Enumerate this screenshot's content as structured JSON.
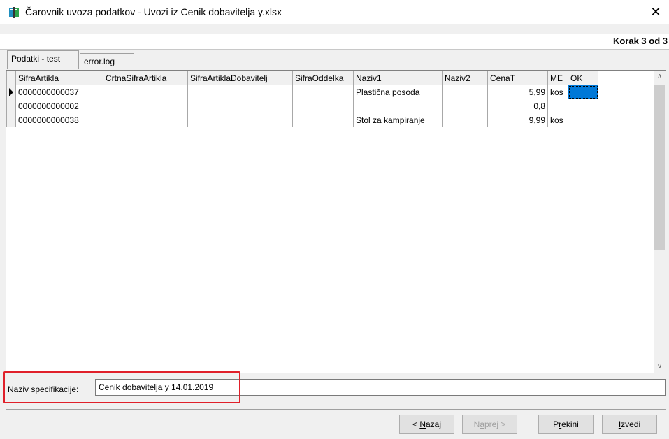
{
  "window": {
    "title": "Čarovnik uvoza podatkov - Uvozi iz Cenik dobavitelja y.xlsx",
    "close_glyph": "✕",
    "app_icon": "wizard-book-icon"
  },
  "step": {
    "label": "Korak 3 od 3"
  },
  "tabs": [
    {
      "label": "Podatki - test",
      "active": true
    },
    {
      "label": "error.log",
      "active": false
    }
  ],
  "grid": {
    "columns": [
      "SifraArtikla",
      "CrtnaSifraArtikla",
      "SifraArtiklaDobavitelj",
      "SifraOddelka",
      "Naziv1",
      "Naziv2",
      "CenaT",
      "ME",
      "OK"
    ],
    "rows": [
      {
        "SifraArtikla": "0000000000037",
        "CrtnaSifraArtikla": "",
        "SifraArtiklaDobavitelj": "",
        "SifraOddelka": "",
        "Naziv1": "Plastična posoda",
        "Naziv2": "",
        "CenaT": "5,99",
        "ME": "kos",
        "OK": "",
        "current": true
      },
      {
        "SifraArtikla": "0000000000002",
        "CrtnaSifraArtikla": "",
        "SifraArtiklaDobavitelj": "",
        "SifraOddelka": "",
        "Naziv1": "",
        "Naziv2": "",
        "CenaT": "0,8",
        "ME": "",
        "OK": "",
        "current": false
      },
      {
        "SifraArtikla": "0000000000038",
        "CrtnaSifraArtikla": "",
        "SifraArtiklaDobavitelj": "",
        "SifraOddelka": "",
        "Naziv1": "Stol za kampiranje",
        "Naziv2": "",
        "CenaT": "9,99",
        "ME": "kos",
        "OK": "",
        "current": false
      }
    ],
    "scroll_up_glyph": "∧",
    "scroll_down_glyph": "∨"
  },
  "spec": {
    "label": "Naziv specifikacije:",
    "value": "Cenik dobavitelja y 14.01.2019"
  },
  "buttons": {
    "back": {
      "prefix": "< ",
      "mnemonic": "N",
      "rest": "azaj"
    },
    "next": {
      "prefix": "",
      "before": "N",
      "mnemonic": "a",
      "rest": "prej >"
    },
    "cancel": {
      "before": "P",
      "mnemonic": "r",
      "rest": "ekini"
    },
    "execute": {
      "mnemonic": "I",
      "rest": "zvedi"
    }
  },
  "colors": {
    "selection": "#0078d7",
    "highlight": "#e0202a",
    "frame": "#f0f0f0"
  }
}
